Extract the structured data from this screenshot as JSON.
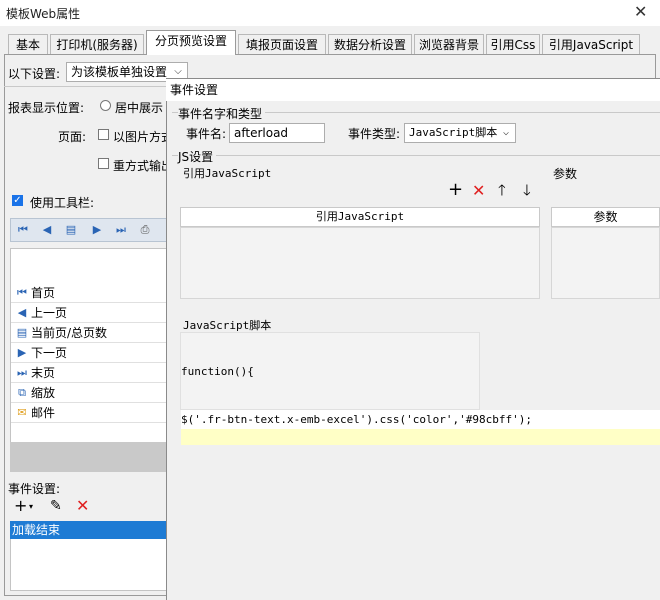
{
  "window": {
    "title": "模板Web属性",
    "close_glyph": "✕"
  },
  "tabs": [
    {
      "label": "基本"
    },
    {
      "label": "打印机(服务器)"
    },
    {
      "label": "分页预览设置"
    },
    {
      "label": "填报页面设置"
    },
    {
      "label": "数据分析设置"
    },
    {
      "label": "浏览器背景"
    },
    {
      "label": "引用Css"
    },
    {
      "label": "引用JavaScript"
    }
  ],
  "settings": {
    "following_label": "以下设置:",
    "following_value": "为该模板单独设置",
    "report_pos_label": "报表显示位置:",
    "center_label": "居中展示",
    "page_label": "页面:",
    "image_option_label": "以图片方式",
    "reset_option_label": "重方式输出",
    "use_toolbar_label": "使用工具栏:"
  },
  "toolbar_items": [
    {
      "label": "首页"
    },
    {
      "label": "上一页"
    },
    {
      "label": "当前页/总页数"
    },
    {
      "label": "下一页"
    },
    {
      "label": "末页"
    },
    {
      "label": "缩放"
    },
    {
      "label": "邮件"
    }
  ],
  "events": {
    "label": "事件设置:",
    "selected_item": "加载结束"
  },
  "dialog": {
    "title": "事件设置",
    "name_group_label": "事件名字和类型",
    "event_name_label": "事件名:",
    "event_name_value": "afterload",
    "event_type_label": "事件类型:",
    "event_type_value": "JavaScript脚本",
    "js_group_label": "JS设置",
    "ref_js_label": "引用JavaScript",
    "params_label": "参数",
    "grid_ref_header": "引用JavaScript",
    "grid_params_header": "参数",
    "script_label": "JavaScript脚本",
    "code_line_1": "function(){",
    "code_line_2": "$('.fr-btn-text.x-emb-excel').css('color','#98cbff');"
  },
  "colors": {
    "selection": "#1e7bd4",
    "delete_red": "#e02020",
    "highlight_line": "#ffffc6",
    "code_string": "#a31515"
  }
}
